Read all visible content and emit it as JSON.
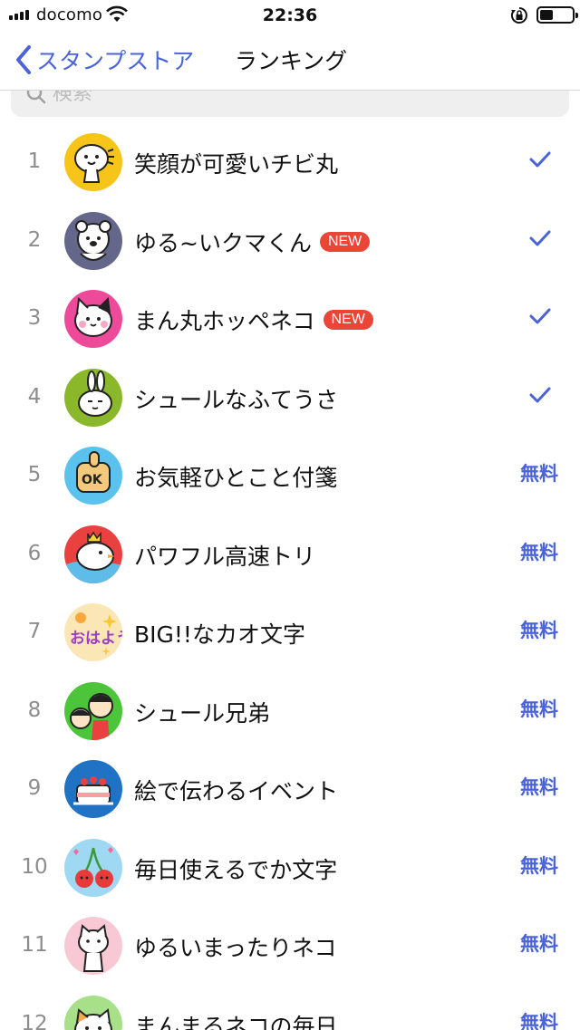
{
  "status_bar": {
    "carrier": "docomo",
    "time": "22:36"
  },
  "nav": {
    "back_label": "スタンプストア",
    "title": "ランキング"
  },
  "search": {
    "placeholder": "検索"
  },
  "colors": {
    "accent": "#4a63d9",
    "new_badge": "#ea4638"
  },
  "ranking": [
    {
      "rank": "1",
      "name": "笑顔が可愛いチビ丸",
      "badge": "",
      "status": "owned"
    },
    {
      "rank": "2",
      "name": "ゆる~いクマくん",
      "badge": "NEW",
      "status": "owned"
    },
    {
      "rank": "3",
      "name": "まん丸ホッペネコ",
      "badge": "NEW",
      "status": "owned"
    },
    {
      "rank": "4",
      "name": "シュールなふてうさ",
      "badge": "",
      "status": "owned"
    },
    {
      "rank": "5",
      "name": "お気軽ひとこと付箋",
      "badge": "",
      "status": "無料"
    },
    {
      "rank": "6",
      "name": "パワフル高速トリ",
      "badge": "",
      "status": "無料"
    },
    {
      "rank": "7",
      "name": "BIG!!なカオ文字",
      "badge": "",
      "status": "無料"
    },
    {
      "rank": "8",
      "name": "シュール兄弟",
      "badge": "",
      "status": "無料"
    },
    {
      "rank": "9",
      "name": "絵で伝わるイベント",
      "badge": "",
      "status": "無料"
    },
    {
      "rank": "10",
      "name": "毎日使えるでか文字",
      "badge": "",
      "status": "無料"
    },
    {
      "rank": "11",
      "name": "ゆるいまったりネコ",
      "badge": "",
      "status": "無料"
    },
    {
      "rank": "12",
      "name": "まんまるネコの毎日",
      "badge": "",
      "status": "無料"
    }
  ]
}
